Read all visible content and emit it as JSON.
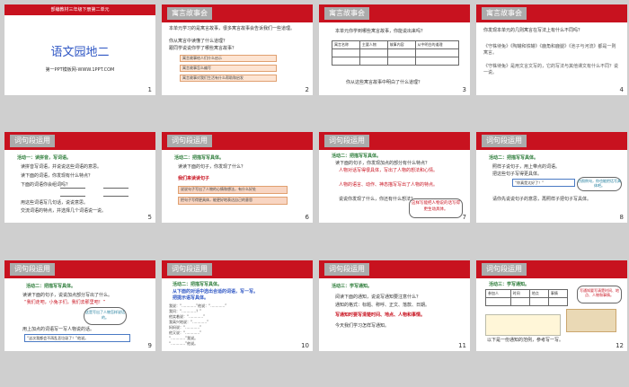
{
  "slides": [
    {
      "number": "1",
      "header": "部编教材三年级下册第二单元",
      "title": "语文园地二",
      "subtitle": "第一PPT模板网-WWW.1PPT.COM"
    },
    {
      "number": "2",
      "tag": "寓言故事会",
      "lines": [
        "本单元学习的是寓言故事，很多寓言故事会告诉我们一些道理。",
        "你从寓言中读懂了什么道理？",
        "跟同学说说你学了哪些寓言故事？"
      ],
      "list": [
        "寓言故事给人们什么启示",
        "寓言故事怎么编写",
        "寓言故事对我们生活有什么帮助和启发"
      ]
    },
    {
      "number": "3",
      "tag": "寓言故事会",
      "intro": "本单元你学到哪些寓言故事，你能说出来吗？",
      "headers": [
        "寓言名称",
        "主要人物",
        "故事内容",
        "从中明白的道理"
      ],
      "question": "你从这些寓言故事中明白了什么道理？"
    },
    {
      "number": "4",
      "tag": "寓言故事会",
      "lines": [
        "你发现本单元的几则寓言在写法上有什么不同吗？",
        "《守株待兔》《陶罐和铁罐》《鹿角和鹿腿》《池子与河流》都是一则寓言。",
        "《守株待兔》是用文言文写的，它的写法与其他课文有什么不同？说一说。"
      ]
    },
    {
      "number": "5",
      "tag": "词句段运用",
      "activity": "活动一：读拼音，写词语。",
      "lines": [
        "读拼音写词语，并说说这些词语的意思。",
        "读下面的词语，你发现有什么特点？",
        "下面的词语你会组词吗？",
        "用这些词语写几句话，说说意思。",
        "交流词语的特点，并选择几个词语说一说。"
      ]
    },
    {
      "number": "6",
      "tag": "词句段运用",
      "activity": "活动二：把描写写具体。",
      "lines": [
        "读读下面的句子，你发现了什么？"
      ],
      "highlight": "我们来读读句子",
      "list": [
        "说说句子写出了人物的心情和想法，有什么好处",
        "把句子写得更具体，能更好地表达自己的意思"
      ]
    },
    {
      "number": "7",
      "tag": "词句段运用",
      "activity": "活动二：把描写写具体。",
      "lines": [
        "读下面的句子，你发现加点的部分有什么特点？",
        "人物对话写得很具体，写出了人物的想法和心情。",
        "人物的语言、动作、神态描写写出了人物的特点。",
        "说说你发现了什么，你还有什么想法？"
      ],
      "bubble": "这样写能把人物说的话写得更生动具体。"
    },
    {
      "number": "8",
      "tag": "词句段运用",
      "activity": "活动二：把描写写具体。",
      "lines": [
        "照样子说句子，用上带点的词语。",
        "把这些句子写得更具体。"
      ],
      "box": "“你真是太好了！”",
      "cloud": "仿照例句，你也能把话写具体吧。",
      "tail": "请你先说说句子的意思，再照样子把句子写具体。"
    },
    {
      "number": "9",
      "tag": "词句段运用",
      "activity": "活动二：把描写写具体。",
      "lines": [
        "读读下面的句子，说说加点部分写出了什么。",
        "“我们走吧，小兔子们，我们去那里吧！”",
        "用上加点的词语写一写人物说的话。"
      ],
      "cloud": "这是写出了人物怎样说话的。",
      "box": "“这次我都会不再乱丢垃圾了！”他说。"
    },
    {
      "number": "10",
      "tag": "词句段运用",
      "activity": "活动二：把描写写具体。",
      "lines": [
        "从下面的对话中选出合适的词语，写一写。",
        "把提示语写具体。"
      ],
      "rows": [
        "我说：“…………”他说：“…………”",
        "我问：“…………？”",
        "他笑着说：“…………”",
        "我高兴地说：“…………”",
        "妈妈说：“…………”",
        "他又说：“…………”",
        "“…………”我说。",
        "“…………”他说。",
        "我们一起说：“…………”"
      ]
    },
    {
      "number": "11",
      "tag": "词句段运用",
      "activity": "活动三：学写通知。",
      "lines": [
        "阅读下面的通知，说说写通知要注意什么？",
        "通知的格式：标题、称呼、正文、落款、日期。",
        "写通知时要写清楚时间、地点、人物和事情。",
        "今天我们学习怎样写通知。"
      ]
    },
    {
      "number": "12",
      "tag": "词句段运用",
      "activity": "活动三：学写通知。",
      "headers": [
        "参加人",
        "时间",
        "地点",
        "事情"
      ],
      "bubble": "写通知要写清楚时间、地点、人物和事情。",
      "bottom": "以下是一份通知的范例，参考写一写。"
    }
  ]
}
